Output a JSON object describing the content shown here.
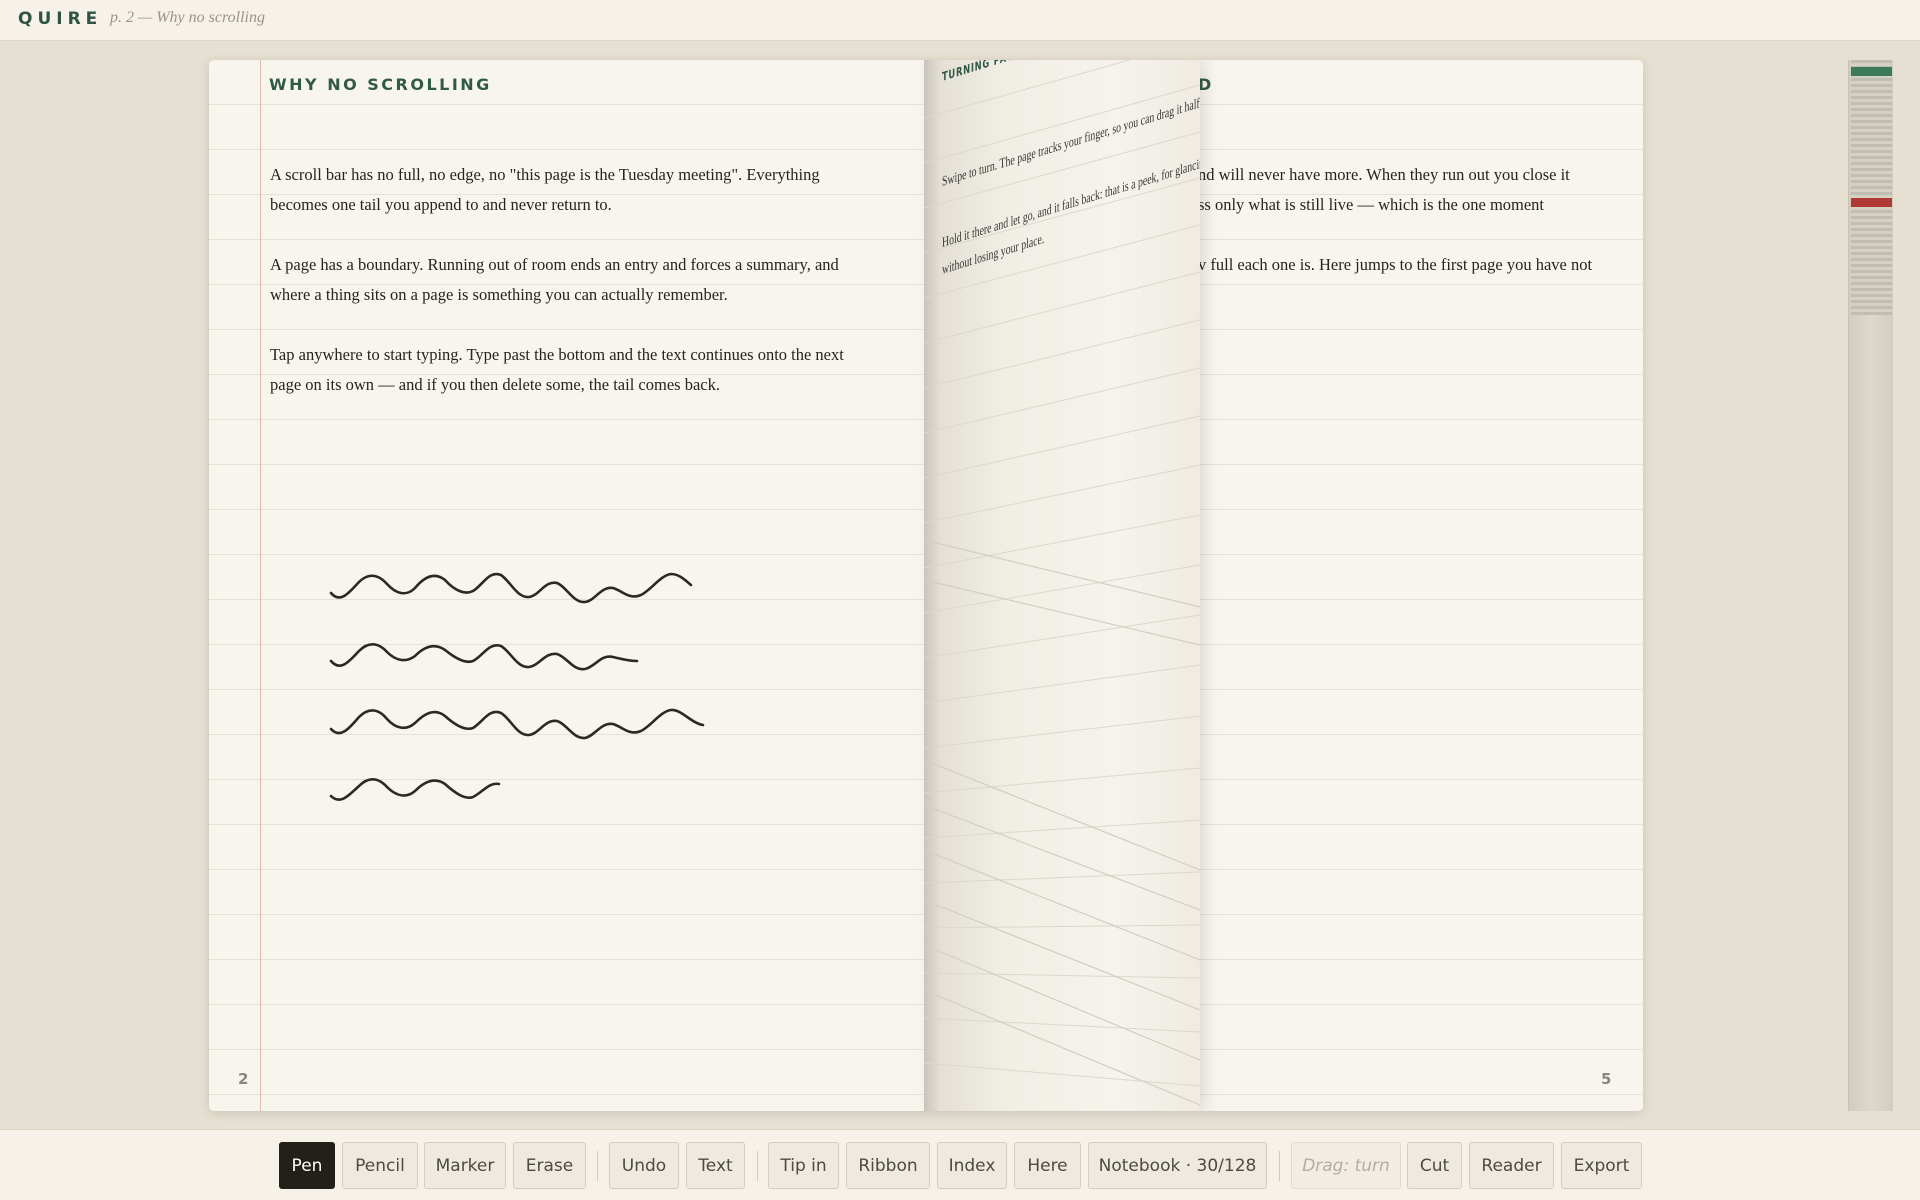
{
  "app": {
    "brand": "QUIRE",
    "crumb": "p. 2 — Why no scrolling"
  },
  "left_page": {
    "title": "WHY NO SCROLLING",
    "paragraphs": [
      [
        "A scroll bar has no full, no edge, no \"this page is the Tuesday meeting\". Everything",
        "becomes one tail you append to and never return to."
      ],
      [
        "A page has a boundary. Running out of room ends an entry and forces a summary, and",
        "where a thing sits on a page is something you can actually remember."
      ],
      [
        "Tap anywhere to start typing. Type past the bottom and the text continues onto the next",
        "page on its own — and if you then delete some, the tail comes back."
      ]
    ],
    "page_number": "2",
    "ink_strokes": 4
  },
  "turning_page": {
    "title": "TURNING PAGE",
    "lines": [
      "Swipe to turn. The page tracks your finger, so you can drag it half-way up and stop.",
      "Hold it there and let go, and it falls back: that is a peek, for glancing at the page behind",
      "without losing your place."
    ]
  },
  "right_page": {
    "title_fragment": "D",
    "lines": [
      "nd will never have more. When they run out you close it",
      "ss only what is still live — which is the one moment",
      "v full each one is. Here jumps to the first page you have not"
    ],
    "page_number": "5"
  },
  "rail": {
    "accent_top": "#3d7a5a",
    "accent_mark": "#b23a34"
  },
  "toolbar": {
    "pen": "Pen",
    "pencil": "Pencil",
    "marker": "Marker",
    "erase": "Erase",
    "undo": "Undo",
    "text": "Text",
    "tip_in": "Tip in",
    "ribbon": "Ribbon",
    "index": "Index",
    "here": "Here",
    "notebook": "Notebook · 30/128",
    "drag": "Drag: turn",
    "cut": "Cut",
    "reader": "Reader",
    "export": "Export",
    "active": "Pen"
  }
}
